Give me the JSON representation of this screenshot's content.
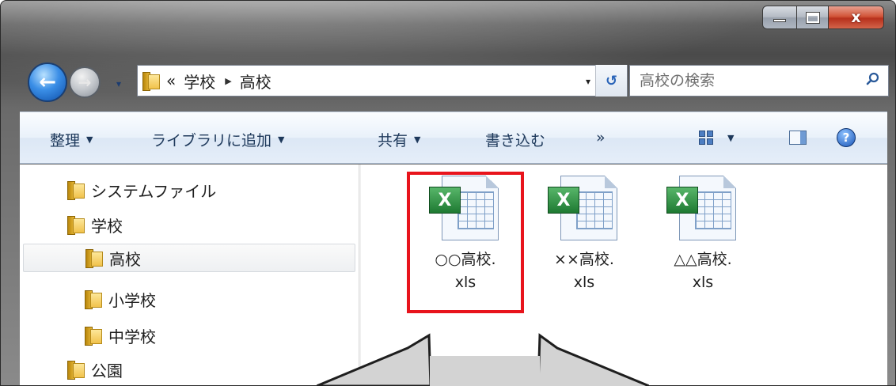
{
  "window": {
    "caption_min": "–",
    "caption_max": "□",
    "caption_close": "x"
  },
  "nav": {
    "back_glyph": "←",
    "forward_glyph": "→",
    "recent_glyph": "▾",
    "address": {
      "chevron": "«",
      "crumbs": [
        "学校",
        "高校"
      ],
      "separator": "▶",
      "dropdown_glyph": "▾",
      "refresh_glyph": "↺"
    },
    "search": {
      "placeholder": "高校の検索"
    }
  },
  "toolbar": {
    "organize": "整理",
    "add_to_library": "ライブラリに追加",
    "share": "共有",
    "burn": "書き込む",
    "more": "»",
    "arrow": "▼",
    "help": "?"
  },
  "tree": {
    "items": [
      {
        "label": "システムファイル",
        "level": 0
      },
      {
        "label": "学校",
        "level": 0
      },
      {
        "label": "高校",
        "level": 1,
        "selected": true
      },
      {
        "label": "小学校",
        "level": 1
      },
      {
        "label": "中学校",
        "level": 1
      },
      {
        "label": "公園",
        "level": 0
      }
    ],
    "scroll_up": "▲",
    "scroll_down": "▼",
    "scroll_grip": "≡"
  },
  "files": [
    {
      "name_line1": "○○高校.",
      "name_line2": "xls",
      "icon": "excel-file-icon",
      "highlighted": true
    },
    {
      "name_line1": "××高校.",
      "name_line2": "xls",
      "icon": "excel-file-icon",
      "highlighted": false
    },
    {
      "name_line1": "△△高校.",
      "name_line2": "xls",
      "icon": "excel-file-icon",
      "highlighted": false
    }
  ],
  "icon_badge": "X",
  "colors": {
    "highlight": "#e8141c",
    "command_text": "#1e395b",
    "callout_fill": "#d3d3d3"
  }
}
